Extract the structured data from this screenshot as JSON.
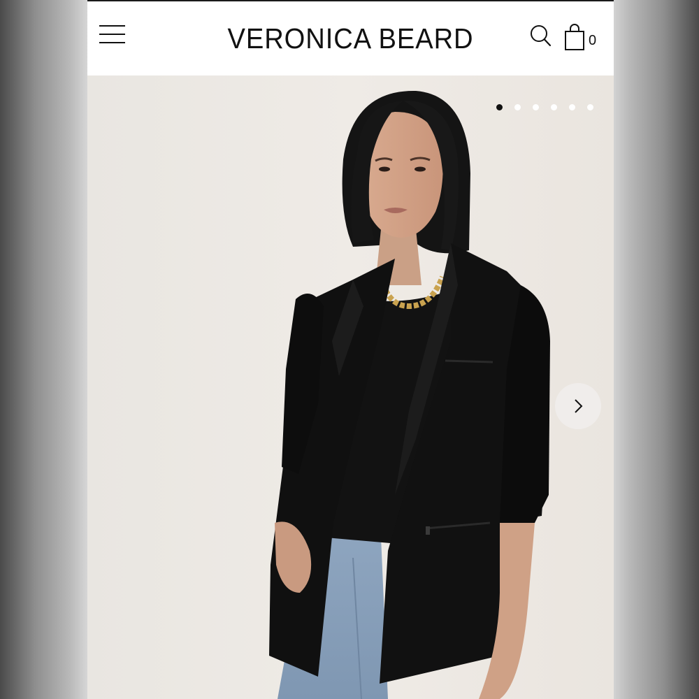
{
  "header": {
    "brand": "VERONICA BEARD",
    "menu_icon": "hamburger-menu-icon",
    "search_icon": "search-icon",
    "bag_icon": "shopping-bag-icon",
    "bag_count": "0"
  },
  "carousel": {
    "slide_count": 6,
    "active_index": 0,
    "next_icon": "chevron-right-icon"
  },
  "colors": {
    "header_bg": "#ffffff",
    "text": "#111111",
    "hero_bg": "#ede9e4",
    "active_dot": "#111111",
    "inactive_dot": "#ffffff"
  }
}
